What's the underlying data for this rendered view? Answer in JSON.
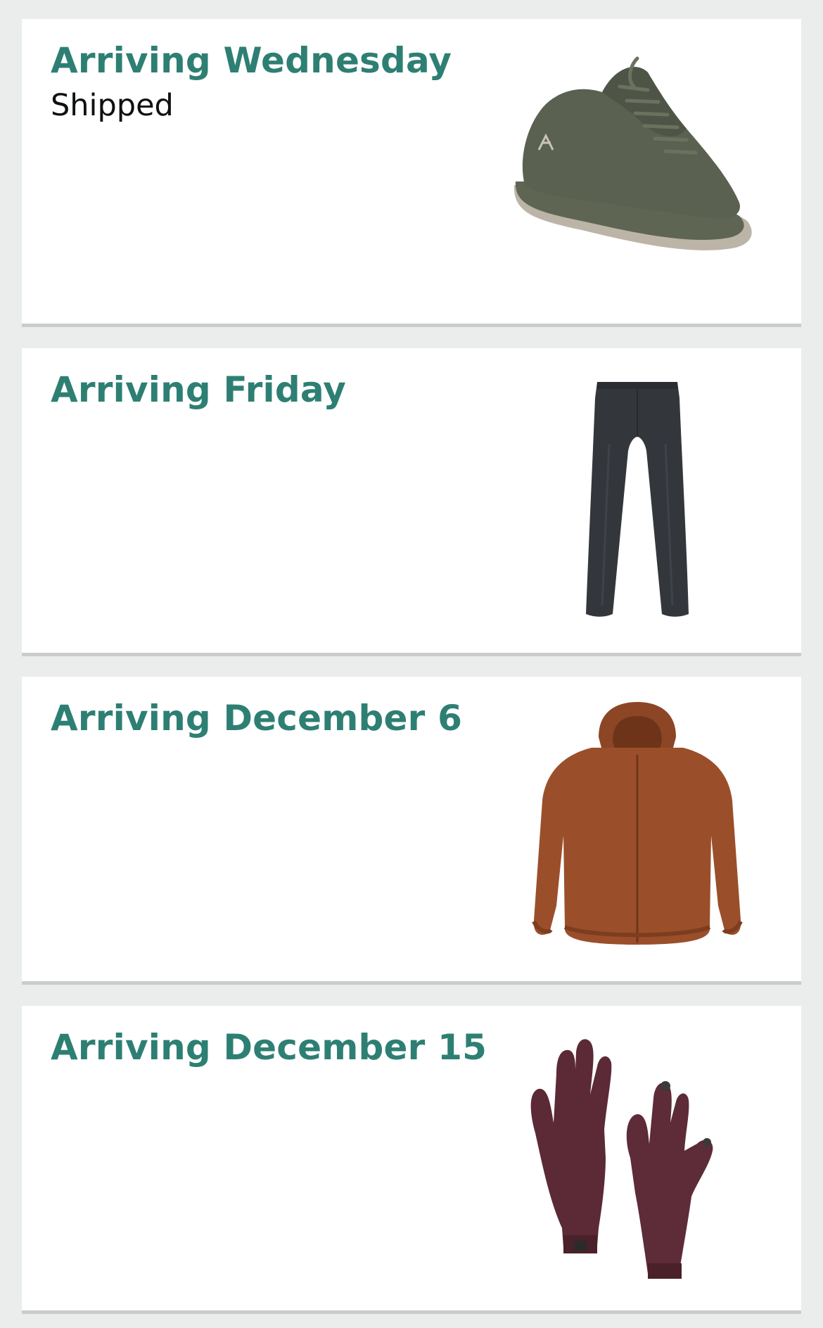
{
  "deliveries": [
    {
      "title": "Arriving Wednesday",
      "subtitle": "Shipped",
      "item_icon": "hiking-shoe",
      "item_color": "#5b6150"
    },
    {
      "title": "Arriving Friday",
      "subtitle": "",
      "item_icon": "pants",
      "item_color": "#33373c"
    },
    {
      "title": "Arriving December 6",
      "subtitle": "",
      "item_icon": "hooded-jacket",
      "item_color": "#9a4f2a"
    },
    {
      "title": "Arriving December 15",
      "subtitle": "",
      "item_icon": "gloves",
      "item_color": "#5b2a36"
    }
  ]
}
